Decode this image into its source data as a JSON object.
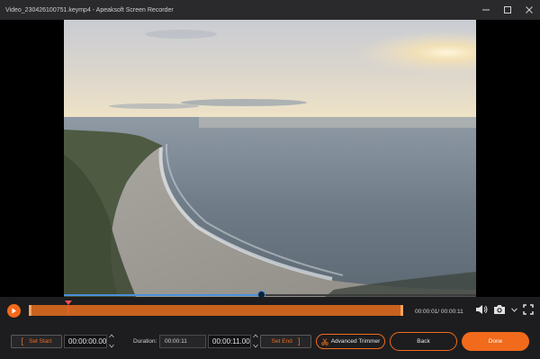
{
  "window": {
    "title": "Video_230426100751.keymp4  -  Apeaksoft Screen Recorder"
  },
  "player": {
    "playback_progress": 0.48,
    "current_time": "00:00:01",
    "total_time": "00:00:11",
    "time_readout": "00:00:01/ 00:00:11"
  },
  "trimmer": {
    "set_start_label": "Set Start",
    "start_time": "00:00:00.00",
    "duration_label": "Duration:",
    "duration_value": "00:00:11",
    "end_time": "00:00:11.00",
    "set_end_label": "Set End",
    "advanced_trimmer_label": "Advanced Trimmer"
  },
  "actions": {
    "back_label": "Back",
    "done_label": "Done"
  },
  "colors": {
    "accent": "#f26a1b",
    "progress": "#4a90d9",
    "clip_bar": "#c9621f",
    "marker": "#ff4d4d"
  },
  "icons": {
    "minimize": "minimize-icon",
    "maximize": "maximize-icon",
    "close": "close-icon",
    "play": "play-icon",
    "volume": "volume-icon",
    "snapshot": "camera-icon",
    "fullscreen": "fullscreen-icon",
    "rotate_left": "rotate-left-icon",
    "flip": "flip-icon",
    "rotate_right": "rotate-right-icon",
    "crop": "crop-icon",
    "edit": "edit-icon",
    "advanced_trimmer": "scissors-icon"
  }
}
